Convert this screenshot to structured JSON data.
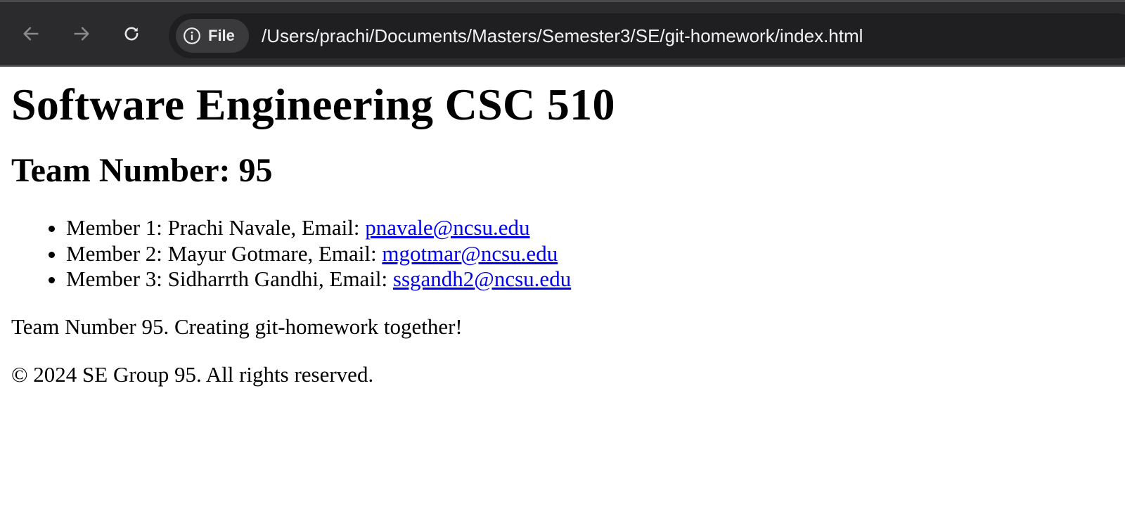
{
  "browser": {
    "site_chip_label": "File",
    "url": "/Users/prachi/Documents/Masters/Semester3/SE/git-homework/index.html",
    "icons": {
      "back": "arrow-left-icon",
      "forward": "arrow-right-icon",
      "reload": "reload-icon",
      "info": "info-icon"
    }
  },
  "page": {
    "title": "Software Engineering CSC 510",
    "team_heading": "Team Number: 95",
    "members": [
      {
        "prefix": "Member 1: Prachi Navale, Email: ",
        "email": "pnavale@ncsu.edu"
      },
      {
        "prefix": "Member 2: Mayur Gotmare, Email: ",
        "email": "mgotmar@ncsu.edu"
      },
      {
        "prefix": "Member 3: Sidharrth Gandhi, Email: ",
        "email": "ssgandh2@ncsu.edu"
      }
    ],
    "tagline": "Team Number 95. Creating git-homework together!",
    "footer": "© 2024 SE Group 95. All rights reserved."
  },
  "colors": {
    "toolbar_bg": "#2b2b2e",
    "omnibox_bg": "#1f1f22",
    "link": "#0000ee"
  }
}
